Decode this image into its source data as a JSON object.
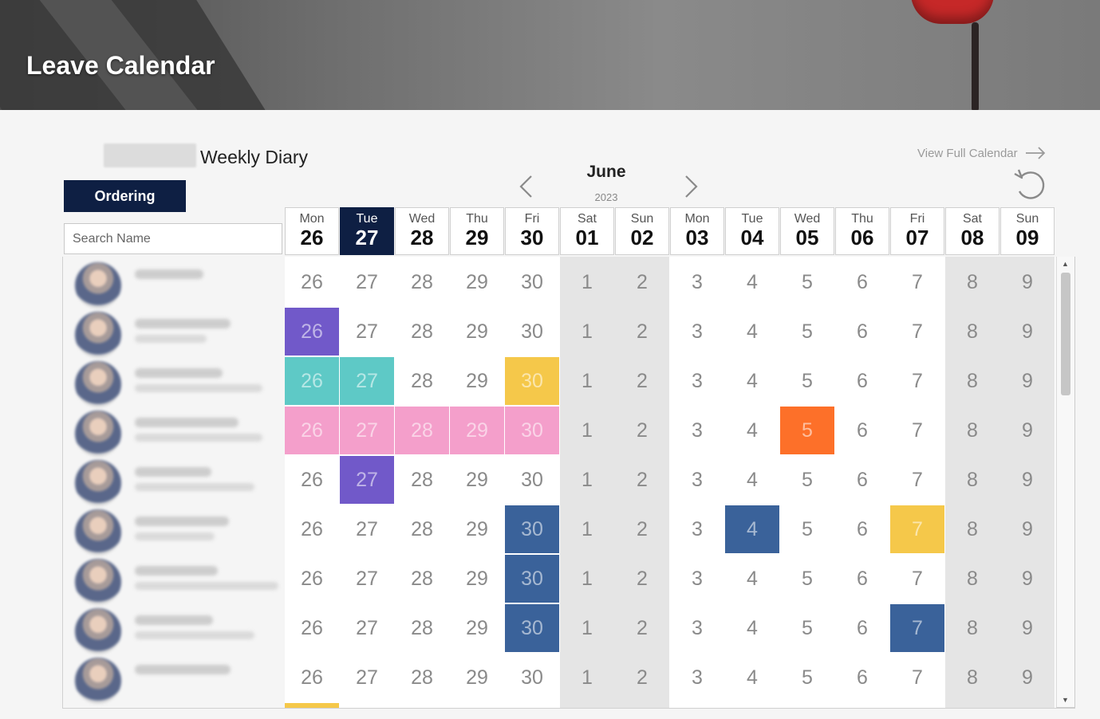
{
  "header": {
    "title": "Leave Calendar"
  },
  "diary": {
    "title": "Weekly Diary"
  },
  "controls": {
    "ordering_label": "Ordering",
    "search_placeholder": "Search Name",
    "view_full_label": "View Full Calendar"
  },
  "calendar": {
    "month": "June",
    "year": "2023",
    "selected_day_index": 1,
    "days": [
      {
        "name": "Mon",
        "num": "26",
        "weekend": false
      },
      {
        "name": "Tue",
        "num": "27",
        "weekend": false
      },
      {
        "name": "Wed",
        "num": "28",
        "weekend": false
      },
      {
        "name": "Thu",
        "num": "29",
        "weekend": false
      },
      {
        "name": "Fri",
        "num": "30",
        "weekend": false
      },
      {
        "name": "Sat",
        "num": "01",
        "weekend": true
      },
      {
        "name": "Sun",
        "num": "02",
        "weekend": true
      },
      {
        "name": "Mon",
        "num": "03",
        "weekend": false
      },
      {
        "name": "Tue",
        "num": "04",
        "weekend": false
      },
      {
        "name": "Wed",
        "num": "05",
        "weekend": false
      },
      {
        "name": "Thu",
        "num": "06",
        "weekend": false
      },
      {
        "name": "Fri",
        "num": "07",
        "weekend": false
      },
      {
        "name": "Sat",
        "num": "08",
        "weekend": true
      },
      {
        "name": "Sun",
        "num": "09",
        "weekend": true
      }
    ],
    "cell_labels": [
      "26",
      "27",
      "28",
      "29",
      "30",
      "1",
      "2",
      "3",
      "4",
      "5",
      "6",
      "7",
      "8",
      "9"
    ],
    "colors": {
      "purple": "#7159c9",
      "teal": "#5ec9c6",
      "yellow": "#f5c84a",
      "pink": "#f49fcb",
      "orange": "#fd7029",
      "blue": "#3a629a",
      "navy": "#0e1f43"
    },
    "rows": [
      {
        "leave": {}
      },
      {
        "leave": {
          "0": "purple"
        }
      },
      {
        "leave": {
          "0": "teal",
          "1": "teal",
          "4": "yellow"
        }
      },
      {
        "leave": {
          "0": "pink",
          "1": "pink",
          "2": "pink",
          "3": "pink",
          "4": "pink",
          "9": "orange"
        }
      },
      {
        "leave": {
          "1": "purple"
        }
      },
      {
        "leave": {
          "4": "blue",
          "8": "blue",
          "11": "yellow"
        }
      },
      {
        "leave": {
          "4": "blue"
        }
      },
      {
        "leave": {
          "4": "blue",
          "11": "blue"
        }
      },
      {
        "leave": {}
      }
    ],
    "partial_row_leave": {
      "0": "yellow"
    }
  }
}
